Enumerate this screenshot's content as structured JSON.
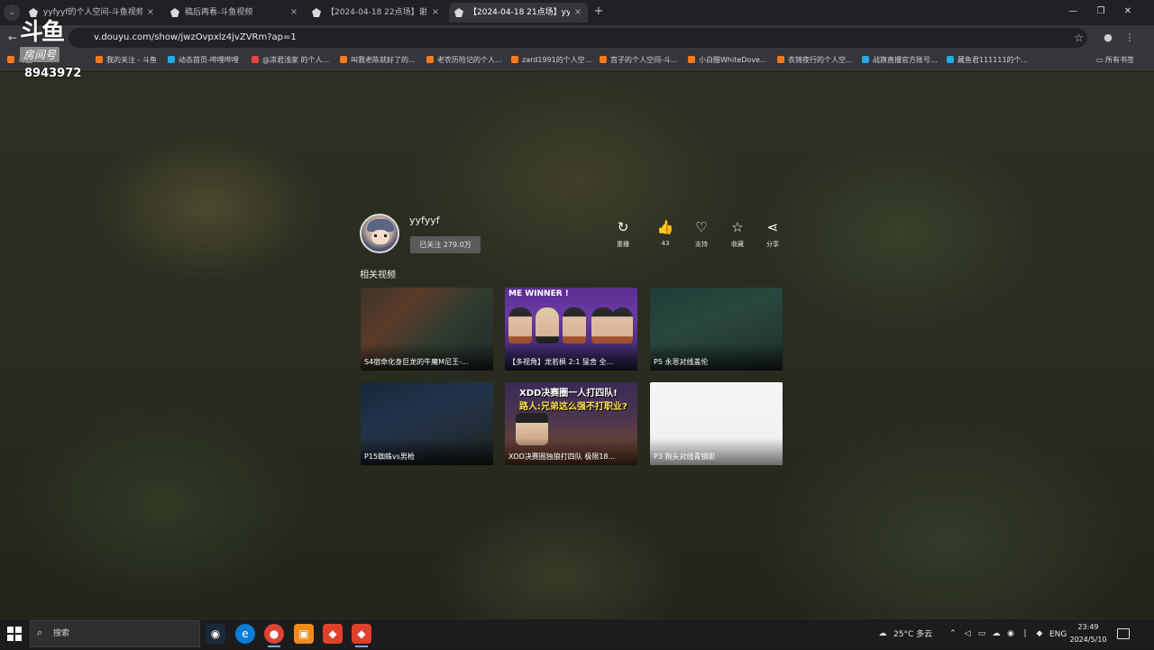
{
  "browser": {
    "tabs": [
      {
        "label": "yyfyyf的个人空间-斗鱼视频",
        "close": "×",
        "active": false
      },
      {
        "label": "稿后再看-斗鱼视频",
        "close": "×",
        "active": false
      },
      {
        "label": "【2024-04-18 22点场】谢谢吃",
        "close": "×",
        "active": false
      },
      {
        "label": "【2024-04-18 21点场】yyfyyf",
        "close": "×",
        "active": true
      }
    ],
    "new_tab": "+",
    "url": "v.douyu.com/show/jwzOvpxlz4jvZVRm?ap=1",
    "bookmarks": [
      {
        "label": "斗鱼",
        "color": "#ff7a1a"
      },
      {
        "label": "我的关注 - 斗鱼",
        "color": "#ff7a1a"
      },
      {
        "label": "动态首页-哔哩哔哩",
        "color": "#23ade5"
      },
      {
        "label": "@凉君浅家 的个人...",
        "color": "#e8453c"
      },
      {
        "label": "叫我老陈就好了的...",
        "color": "#ff7a1a"
      },
      {
        "label": "老农历险记的个人...",
        "color": "#ff7a1a"
      },
      {
        "label": "zard1991的个人空...",
        "color": "#ff7a1a"
      },
      {
        "label": "宫子的个人空间-斗...",
        "color": "#ff7a1a"
      },
      {
        "label": "小白醋WhiteDove...",
        "color": "#ff7a1a"
      },
      {
        "label": "衣锦夜行的个人空...",
        "color": "#ff7a1a"
      },
      {
        "label": "战旗直播官方账号...",
        "color": "#23ade5"
      },
      {
        "label": "藏鱼君111111的个...",
        "color": "#23ade5"
      }
    ],
    "all_bookmarks": "所有书签"
  },
  "watermark": {
    "logo_top": "斗鱼",
    "logo_bottom": "房间号",
    "room_id": "8943972"
  },
  "endcard": {
    "author_name": "yyfyyf",
    "follow_label": "已关注 279.0万",
    "actions": [
      {
        "icon": "↻",
        "label": "重播"
      },
      {
        "icon": "👍",
        "label": "43"
      },
      {
        "icon": "♡",
        "label": "支持"
      },
      {
        "icon": "☆",
        "label": "收藏"
      },
      {
        "icon": "⋖",
        "label": "分享"
      }
    ],
    "related_title": "相关视频",
    "videos": [
      {
        "title": "S4宿命化身巨龙的牛魔M尼王-..."
      },
      {
        "title": "【多视角】龙若枫 2:1 猛舍 全...",
        "banner": "ME WINNER !"
      },
      {
        "title": "P5 永恩对线盖伦"
      },
      {
        "title": "P15蜘蛛vs男枪"
      },
      {
        "title": "XDD决赛圈独狼打四队 极限18...",
        "banner1": "XDD决赛圈一人打四队!",
        "banner2": "路人:兄弟这么强不打职业?"
      },
      {
        "title": "P3 狗头对线青钢影"
      }
    ]
  },
  "taskbar": {
    "search_placeholder": "搜索",
    "weather": "25°C 多云",
    "lang": "ENG",
    "time": "23:49",
    "date": "2024/5/10"
  }
}
